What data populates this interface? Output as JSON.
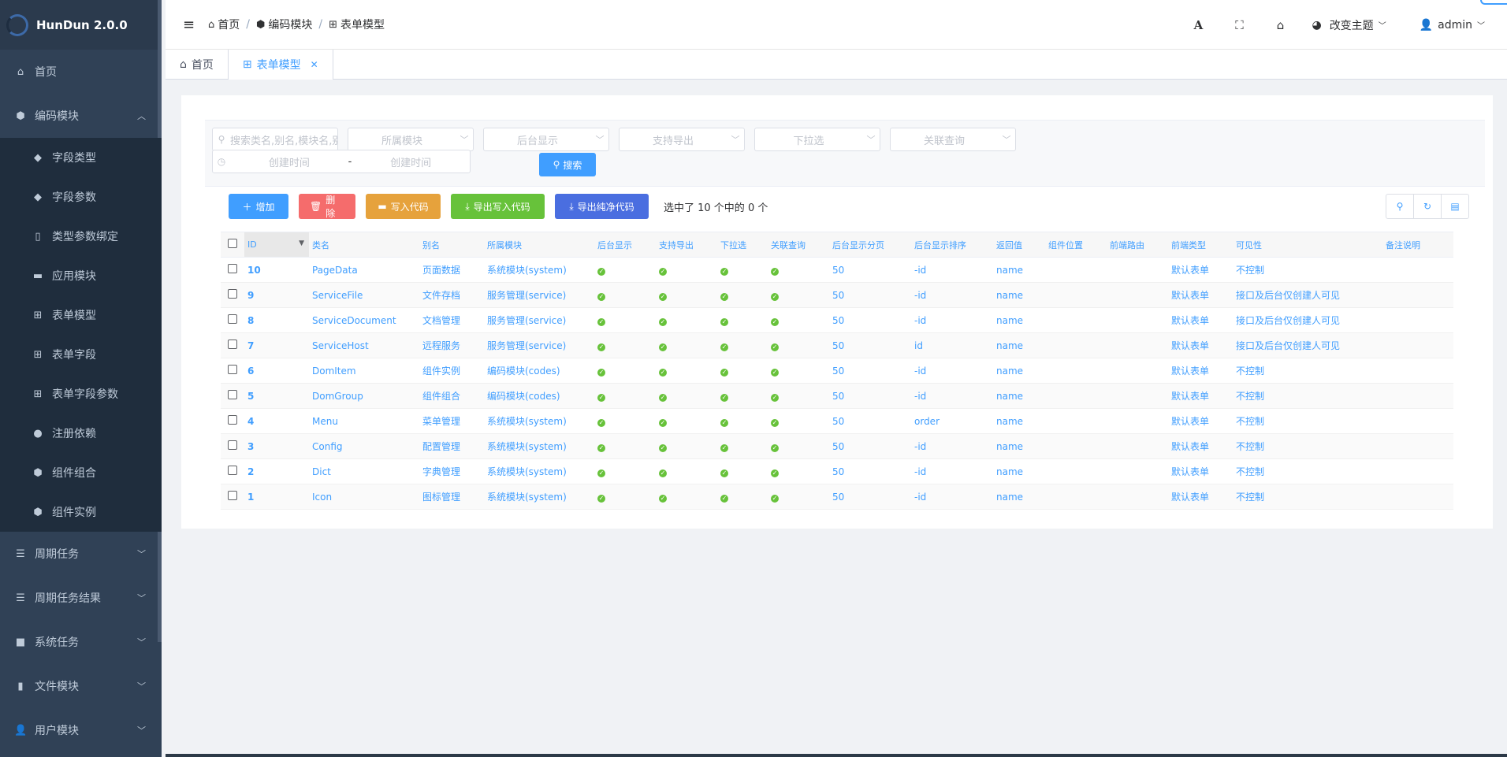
{
  "app": {
    "title": "HunDun 2.0.0"
  },
  "sidebar": {
    "items": [
      {
        "label": "首页",
        "icon": "home-icon"
      },
      {
        "label": "编码模块",
        "icon": "cube-icon",
        "open": true
      },
      {
        "label": "字段类型",
        "icon": "tag-icon"
      },
      {
        "label": "字段参数",
        "icon": "tag-icon"
      },
      {
        "label": "类型参数绑定",
        "icon": "file-icon"
      },
      {
        "label": "应用模块",
        "icon": "folder-icon"
      },
      {
        "label": "表单模型",
        "icon": "table-icon"
      },
      {
        "label": "表单字段",
        "icon": "table-icon"
      },
      {
        "label": "表单字段参数",
        "icon": "table-icon"
      },
      {
        "label": "注册依赖",
        "icon": "circle-icon"
      },
      {
        "label": "组件组合",
        "icon": "cube-icon"
      },
      {
        "label": "组件实例",
        "icon": "cube-icon"
      },
      {
        "label": "周期任务",
        "icon": "list-icon"
      },
      {
        "label": "周期任务结果",
        "icon": "list-icon"
      },
      {
        "label": "系统任务",
        "icon": "square-icon"
      },
      {
        "label": "文件模块",
        "icon": "file-icon"
      },
      {
        "label": "用户模块",
        "icon": "user-icon"
      }
    ]
  },
  "header": {
    "breadcrumb": [
      "首页",
      "编码模块",
      "表单模型"
    ],
    "theme_label": "改变主题",
    "user_label": "admin"
  },
  "tags": [
    {
      "label": "首页"
    },
    {
      "label": "表单模型"
    }
  ],
  "filters": {
    "search_placeholder": "搜索类名,别名,模块名,别名",
    "module": "所属模块",
    "admin_show": "后台显示",
    "export": "支持导出",
    "dropdown": "下拉选",
    "join": "关联查询",
    "created_start": "创建时间",
    "created_end": "创建时间",
    "range_sep": "-",
    "search_button": "搜索"
  },
  "toolbar": {
    "add": "增加",
    "delete": "删除",
    "write_code": "写入代码",
    "export_write_code": "导出写入代码",
    "export_pure_code": "导出纯净代码",
    "selection": "选中了 10 个中的 0 个"
  },
  "table": {
    "columns": [
      "ID",
      "类名",
      "别名",
      "所属模块",
      "后台显示",
      "支持导出",
      "下拉选",
      "关联查询",
      "后台显示分页",
      "后台显示排序",
      "返回值",
      "组件位置",
      "前端路由",
      "前端类型",
      "可见性",
      "备注说明"
    ],
    "rows": [
      [
        "10",
        "PageData",
        "页面数据",
        "系统模块(system)",
        "50",
        "-id",
        "name",
        "默认表单",
        "不控制"
      ],
      [
        "9",
        "ServiceFile",
        "文件存档",
        "服务管理(service)",
        "50",
        "-id",
        "name",
        "默认表单",
        "接口及后台仅创建人可见"
      ],
      [
        "8",
        "ServiceDocument",
        "文档管理",
        "服务管理(service)",
        "50",
        "-id",
        "name",
        "默认表单",
        "接口及后台仅创建人可见"
      ],
      [
        "7",
        "ServiceHost",
        "远程服务",
        "服务管理(service)",
        "50",
        "id",
        "name",
        "默认表单",
        "接口及后台仅创建人可见"
      ],
      [
        "6",
        "DomItem",
        "组件实例",
        "编码模块(codes)",
        "50",
        "-id",
        "name",
        "默认表单",
        "不控制"
      ],
      [
        "5",
        "DomGroup",
        "组件组合",
        "编码模块(codes)",
        "50",
        "-id",
        "name",
        "默认表单",
        "不控制"
      ],
      [
        "4",
        "Menu",
        "菜单管理",
        "系统模块(system)",
        "50",
        "order",
        "name",
        "默认表单",
        "不控制"
      ],
      [
        "3",
        "Config",
        "配置管理",
        "系统模块(system)",
        "50",
        "-id",
        "name",
        "默认表单",
        "不控制"
      ],
      [
        "2",
        "Dict",
        "字典管理",
        "系统模块(system)",
        "50",
        "-id",
        "name",
        "默认表单",
        "不控制"
      ],
      [
        "1",
        "Icon",
        "图标管理",
        "系统模块(system)",
        "50",
        "-id",
        "name",
        "默认表单",
        "不控制"
      ]
    ]
  },
  "colors": {
    "sidebar": "#304156",
    "primary": "#409eff",
    "danger": "#f56c6c",
    "warning": "#e6a23c",
    "success": "#67c23a",
    "info": "#4a6ee0"
  }
}
